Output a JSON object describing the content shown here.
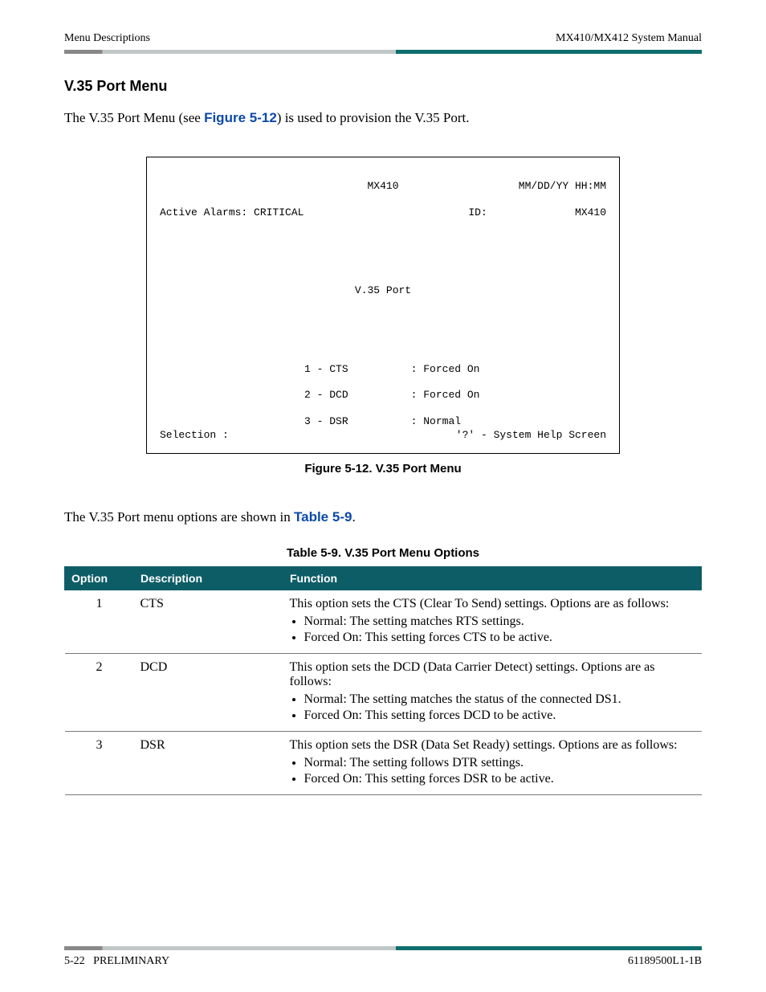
{
  "header": {
    "left": "Menu Descriptions",
    "right": "MX410/MX412 System Manual"
  },
  "section": {
    "heading": "V.35 Port Menu",
    "intro_pre": "The V.35 Port Menu (see ",
    "figure_ref": "Figure 5-12",
    "intro_post": ") is used to provision the V.35 Port."
  },
  "terminal": {
    "top_center": "MX410",
    "top_right": "MM/DD/YY HH:MM",
    "alarms": "Active Alarms: CRITICAL",
    "id_label": "ID:",
    "id_value": "MX410",
    "title": "V.35 Port",
    "items": [
      {
        "num": "1",
        "name": "CTS",
        "value": "Forced On"
      },
      {
        "num": "2",
        "name": "DCD",
        "value": "Forced On"
      },
      {
        "num": "3",
        "name": "DSR",
        "value": "Normal"
      }
    ],
    "selection_label": "Selection :",
    "help_hint": "'?' - System Help Screen"
  },
  "figure_caption": "Figure 5-12.  V.35 Port Menu",
  "between_text_pre": "The V.35 Port menu options are shown in ",
  "table_ref": "Table 5-9",
  "between_text_post": ".",
  "table_caption": "Table 5-9.  V.35 Port Menu Options",
  "table": {
    "headers": {
      "option": "Option",
      "description": "Description",
      "function": "Function"
    },
    "rows": [
      {
        "option": "1",
        "description": "CTS",
        "intro": "This option sets the CTS (Clear To Send) settings. Options are as follows:",
        "bullets": [
          "Normal: The setting matches RTS settings.",
          "Forced On: This setting forces CTS to be active."
        ]
      },
      {
        "option": "2",
        "description": "DCD",
        "intro": "This option sets the DCD (Data Carrier Detect) settings. Options are as follows:",
        "bullets": [
          "Normal: The setting matches the status of the connected DS1.",
          "Forced On: This setting forces DCD to be active."
        ]
      },
      {
        "option": "3",
        "description": "DSR",
        "intro": "This option sets the DSR (Data Set Ready) settings. Options are as follows:",
        "bullets": [
          "Normal: The setting follows DTR settings.",
          "Forced On: This setting forces DSR to be active."
        ]
      }
    ]
  },
  "footer": {
    "left_page": "5-22",
    "left_status": "PRELIMINARY",
    "right": "61189500L1-1B"
  }
}
